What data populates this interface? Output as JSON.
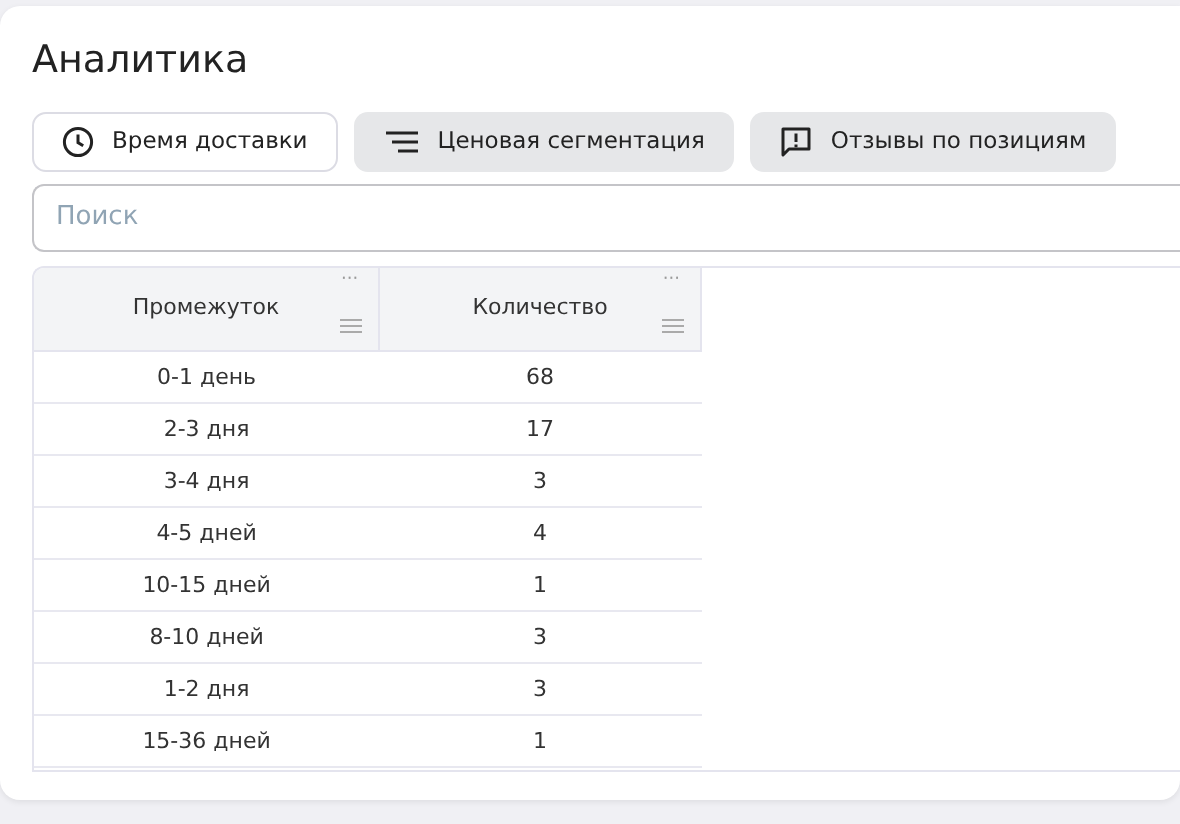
{
  "title": "Аналитика",
  "tabs": [
    {
      "label": "Время доставки",
      "selected": true
    },
    {
      "label": "Ценовая сегментация",
      "selected": false
    },
    {
      "label": "Отзывы по позициям",
      "selected": false
    }
  ],
  "search": {
    "placeholder": "Поиск"
  },
  "table": {
    "columns": [
      {
        "label": "Промежуток",
        "menu": "···"
      },
      {
        "label": "Количество",
        "menu": "···"
      }
    ],
    "rows": [
      [
        "0-1 день",
        "68"
      ],
      [
        "2-3 дня",
        "17"
      ],
      [
        "3-4 дня",
        "3"
      ],
      [
        "4-5 дней",
        "4"
      ],
      [
        "10-15 дней",
        "1"
      ],
      [
        "8-10 дней",
        "3"
      ],
      [
        "1-2 дня",
        "3"
      ],
      [
        "15-36 дней",
        "1"
      ]
    ]
  }
}
